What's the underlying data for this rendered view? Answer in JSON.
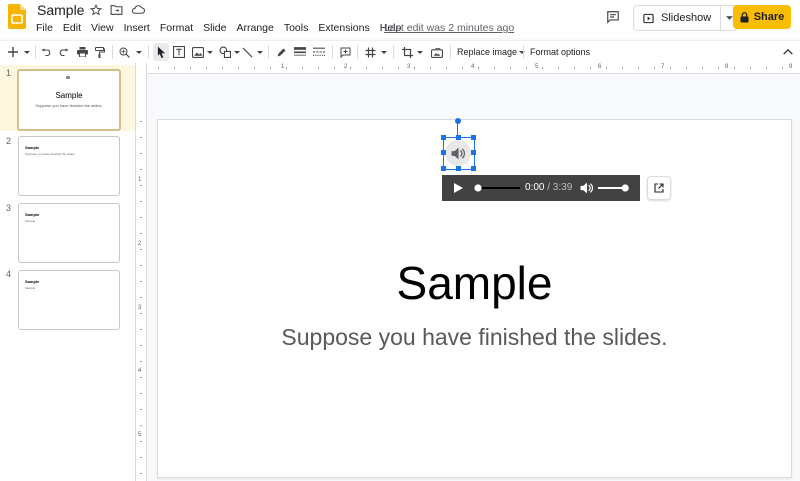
{
  "document": {
    "title": "Sample",
    "last_edit": "Last edit was 2 minutes ago"
  },
  "menu": [
    "File",
    "Edit",
    "View",
    "Insert",
    "Format",
    "Slide",
    "Arrange",
    "Tools",
    "Extensions",
    "Help"
  ],
  "header": {
    "slideshow_label": "Slideshow",
    "share_label": "Share"
  },
  "toolbar": {
    "replace_image_label": "Replace image",
    "format_options_label": "Format options"
  },
  "filmstrip": {
    "slides": [
      {
        "number": "1",
        "title": "Sample",
        "subtitle": "Suppose you have finished the slides."
      },
      {
        "number": "2",
        "title": "Sample",
        "subtitle": "Suppose you have finished the slides."
      },
      {
        "number": "3",
        "title": "Sample",
        "subtitle": "Sample"
      },
      {
        "number": "4",
        "title": "Sample",
        "subtitle": "Sample"
      }
    ]
  },
  "rulers": {
    "horizontal": [
      "1",
      "2",
      "3",
      "4",
      "5",
      "6",
      "7",
      "8",
      "9"
    ],
    "vertical": [
      "1",
      "2",
      "3",
      "4",
      "5"
    ]
  },
  "slide": {
    "title": "Sample",
    "subtitle": "Suppose you have finished the slides."
  },
  "audio_player": {
    "current_time": "0:00",
    "duration": "/ 3:39",
    "progress": 0,
    "volume": 0.9
  },
  "colors": {
    "share": "#fbbc04",
    "selection": "#1a73e8",
    "player_bg": "#424242",
    "app_logo": "#f4b400"
  }
}
